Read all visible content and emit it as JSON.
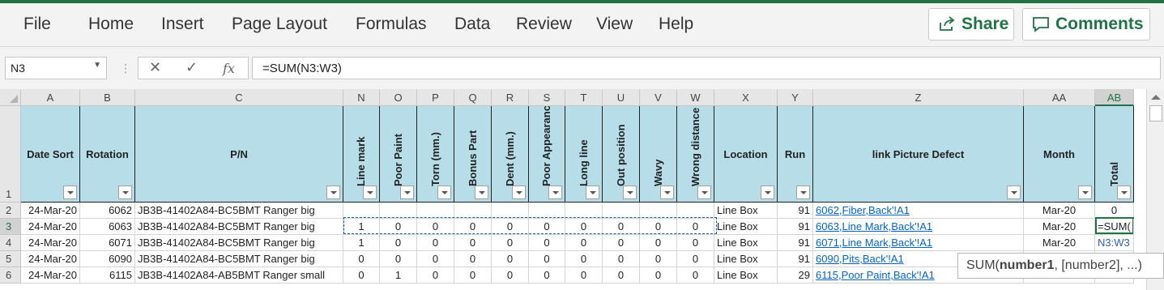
{
  "ribbon": {
    "tabs": [
      "File",
      "Home",
      "Insert",
      "Page Layout",
      "Formulas",
      "Data",
      "Review",
      "View",
      "Help"
    ],
    "share_label": "Share",
    "comments_label": "Comments"
  },
  "formula_bar": {
    "name_box": "N3",
    "formula": "=SUM(N3:W3)"
  },
  "columns": [
    "A",
    "B",
    "C",
    "N",
    "O",
    "P",
    "Q",
    "R",
    "S",
    "T",
    "U",
    "V",
    "W",
    "X",
    "Y",
    "Z",
    "AA",
    "AB"
  ],
  "active_column": "AB",
  "headers": {
    "date_sort": "Date Sort",
    "rotation": "Rotation",
    "pn": "P/N",
    "line_mark": "Line mark",
    "poor_paint": "Poor Paint",
    "torn": "Torn (mm.)",
    "bonus_part": "Bonus Part",
    "dent": "Dent (mm.)",
    "poor_appearance": "Poor Appearance",
    "long_line": "Long line",
    "out_position": "Out position",
    "wavy": "Wavy",
    "wrong_distance": "Wrong distance",
    "location": "Location",
    "run": "Run",
    "link": "link Picture Defect",
    "month": "Month",
    "total": "Total"
  },
  "rows": [
    {
      "num": "2",
      "date": "24-Mar-20",
      "rot": "6062",
      "pn": "JB3B-41402A84-BC5BMT Ranger big",
      "vals": [
        "",
        "",
        "",
        "",
        "",
        "",
        "",
        "",
        "",
        ""
      ],
      "loc": "Line Box",
      "run": "91",
      "link": "6062,Fiber,Back'!A1",
      "month": "Mar-20",
      "total": "0"
    },
    {
      "num": "3",
      "date": "24-Mar-20",
      "rot": "6063",
      "pn": "JB3B-41402A84-BC5BMT Ranger big",
      "vals": [
        "1",
        "0",
        "0",
        "0",
        "0",
        "0",
        "0",
        "0",
        "0",
        "0"
      ],
      "loc": "Line Box",
      "run": "91",
      "link": "6063,Line Mark,Back'!A1",
      "month": "Mar-20",
      "total": "=SUM("
    },
    {
      "num": "4",
      "date": "24-Mar-20",
      "rot": "6071",
      "pn": "JB3B-41402A84-BC5BMT Ranger big",
      "vals": [
        "1",
        "0",
        "0",
        "0",
        "0",
        "0",
        "0",
        "0",
        "0",
        "0"
      ],
      "loc": "Line Box",
      "run": "91",
      "link": "6071,Line Mark,Back'!A1",
      "month": "Mar-20",
      "total": "N3:W3"
    },
    {
      "num": "5",
      "date": "24-Mar-20",
      "rot": "6090",
      "pn": "JB3B-41402A84-BC5BMT Ranger big",
      "vals": [
        "0",
        "0",
        "0",
        "0",
        "0",
        "0",
        "0",
        "0",
        "0",
        "0"
      ],
      "loc": "Line Box",
      "run": "91",
      "link": "6090,Pits,Back'!A1",
      "month": "",
      "total": ""
    },
    {
      "num": "6",
      "date": "24-Mar-20",
      "rot": "6115",
      "pn": "JB3B-41402A84-AB5BMT Ranger small",
      "vals": [
        "0",
        "1",
        "0",
        "0",
        "0",
        "0",
        "0",
        "0",
        "0",
        "0"
      ],
      "loc": "Line Box",
      "run": "29",
      "link": "6115,Poor Paint,Back'!A1",
      "month": "",
      "total": ""
    }
  ],
  "tooltip": "SUM(number1, [number2], ...)"
}
